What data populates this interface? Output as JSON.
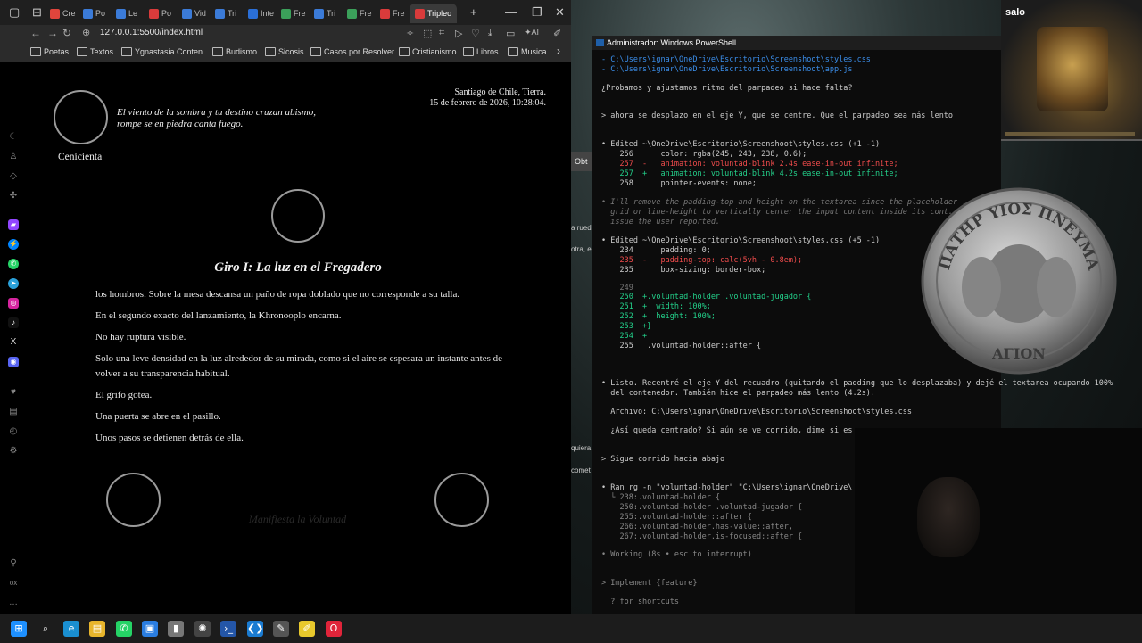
{
  "browser": {
    "tabs": [
      {
        "label": "Cre",
        "color": "#e0453c"
      },
      {
        "label": "Po",
        "color": "#3b7bd8"
      },
      {
        "label": "Le",
        "color": "#3b7bd8"
      },
      {
        "label": "Po",
        "color": "#d93b3b"
      },
      {
        "label": "Vid",
        "color": "#3b7bd8"
      },
      {
        "label": "Tri",
        "color": "#3b7bd8"
      },
      {
        "label": "Inte",
        "color": "#2a6fd8"
      },
      {
        "label": "Fre",
        "color": "#3ba05a"
      },
      {
        "label": "Tri",
        "color": "#3b7bd8"
      },
      {
        "label": "Fre",
        "color": "#3ba05a"
      },
      {
        "label": "Fre",
        "color": "#d93b3b"
      },
      {
        "label": "Tripleo",
        "color": "#d93b3b",
        "active": true
      }
    ],
    "new_tab_symbol": "+",
    "url": "127.0.0.1:5500/index.html",
    "ai_label": "AI",
    "bookmarks": [
      "Poetas",
      "Textos",
      "Ygnastasia Conten...",
      "Budismo",
      "Sicosis",
      "Casos por Resolver",
      "Cristianismo",
      "Libros",
      "Musica"
    ],
    "bookmarks_more": "›"
  },
  "page": {
    "quote_line1": "El viento de la sombra y tu destino cruzan abismo,",
    "quote_line2": "rompe se en piedra canta fuego.",
    "avatar_name": "Cenicienta",
    "location": "Santiago de Chile, Tierra.",
    "datetime": "15 de febrero de 2026, 10:28:04.",
    "chapter_title": "Giro I: La luz en el Fregadero",
    "paragraphs": [
      "los hombros. Sobre la mesa descansa un paño de ropa doblado que no corresponde a su talla.",
      "En el segundo exacto del lanzamiento, la Khronooplo encarna.",
      "No hay ruptura visible.",
      "Solo una leve densidad en la luz alrededor de su mirada, como si el aire se espesara un instante antes de volver a su transparencia habitual.",
      "El grifo gotea.",
      "Una puerta se abre en el pasillo.",
      "Unos pasos se detienen detrás de ella."
    ],
    "voluntad_placeholder": "Manifiesta la Voluntad"
  },
  "desktop": {
    "obt_label": "Obt",
    "clip_texts": [
      "a rueda",
      "otra, e",
      "quiera",
      "comet"
    ]
  },
  "powershell": {
    "title": "Administrador: Windows PowerShell",
    "lines": [
      {
        "t": "- C:\\Users\\ignar\\OneDrive\\Escritorio\\Screenshoot\\styles.css",
        "c": "path"
      },
      {
        "t": "- C:\\Users\\ignar\\OneDrive\\Escritorio\\Screenshoot\\app.js",
        "c": "path"
      },
      {
        "t": "¿Probamos y ajustamos ritmo del parpadeo si hace falta?",
        "c": ""
      },
      {
        "t": "> ahora se desplazo en el eje Y, que se centre. Que el parpadeo sea más lento",
        "c": ""
      },
      {
        "t": "• Edited ~\\OneDrive\\Escritorio\\Screenshoot\\styles.css (+1 -1)",
        "c": ""
      },
      {
        "t": "    256      color: rgba(245, 243, 238, 0.6);",
        "c": ""
      },
      {
        "t": "    257  -   animation: voluntad-blink 2.4s ease-in-out infinite;",
        "c": "red"
      },
      {
        "t": "    257  +   animation: voluntad-blink 4.2s ease-in-out infinite;",
        "c": "green"
      },
      {
        "t": "    258      pointer-events: none;",
        "c": ""
      },
      {
        "t": "• I'll remove the padding-top and height on the textarea since the placeholder ... se display",
        "c": "ital"
      },
      {
        "t": "  grid or line-height to vertically center the input content inside its cont... -shift",
        "c": "ital"
      },
      {
        "t": "  issue the user reported.",
        "c": "ital"
      },
      {
        "t": "• Edited ~\\OneDrive\\Escritorio\\Screenshoot\\styles.css (+5 -1)",
        "c": ""
      },
      {
        "t": "    234      padding: 0;",
        "c": ""
      },
      {
        "t": "    235  -   padding-top: calc(5vh - 0.8em);",
        "c": "red"
      },
      {
        "t": "    235      box-sizing: border-box;",
        "c": ""
      },
      {
        "t": "    249",
        "c": "lnum"
      },
      {
        "t": "    250  +.voluntad-holder .voluntad-jugador {",
        "c": "green"
      },
      {
        "t": "    251  +  width: 100%;",
        "c": "green"
      },
      {
        "t": "    252  +  height: 100%;",
        "c": "green"
      },
      {
        "t": "    253  +}",
        "c": "green"
      },
      {
        "t": "    254  +",
        "c": "green"
      },
      {
        "t": "    255   .voluntad-holder::after {",
        "c": ""
      },
      {
        "t": "• Listo. Recentré el eje Y del recuadro (quitando el padding que lo desplazaba) y dejé el textarea ocupando 100%",
        "c": ""
      },
      {
        "t": "  del contenedor. También hice el parpadeo más lento (4.2s).",
        "c": ""
      },
      {
        "t": "  Archivo: C:\\Users\\ignar\\OneDrive\\Escritorio\\Screenshoot\\styles.css",
        "c": ""
      },
      {
        "t": "  ¿Así queda centrado? Si aún se ve corrido, dime si es ...",
        "c": ""
      },
      {
        "t": "> Sigue corrido hacia abajo",
        "c": ""
      },
      {
        "t": "• Ran rg -n \"voluntad-holder\" \"C:\\Users\\ignar\\OneDrive\\",
        "c": ""
      },
      {
        "t": "  └ 238:.voluntad-holder {",
        "c": "dim"
      },
      {
        "t": "    250:.voluntad-holder .voluntad-jugador {",
        "c": "dim"
      },
      {
        "t": "    255:.voluntad-holder::after {",
        "c": "dim"
      },
      {
        "t": "    266:.voluntad-holder.has-value::after,",
        "c": "dim"
      },
      {
        "t": "    267:.voluntad-holder.is-focused::after {",
        "c": "dim"
      },
      {
        "t": "• Working (8s • esc to interrupt)",
        "c": "dim"
      },
      {
        "t": "> Implement {feature}",
        "c": "dim"
      },
      {
        "t": "  ? for shortcuts",
        "c": "dim"
      }
    ]
  },
  "overlays": {
    "salo_label": "salo",
    "coin_top_text": "ΠΑΤΗΡ ΥΙΟΣ ΠΝΕΥΜΑ",
    "coin_bottom_text": "ΑΓΙΟΝ"
  },
  "taskbar": {
    "items": [
      {
        "name": "windows-start-icon",
        "glyph": "⊞",
        "color": "#1e90ff"
      },
      {
        "name": "search-icon",
        "glyph": "⌕",
        "color": "#1c1c1c"
      },
      {
        "name": "edge-icon",
        "glyph": "e",
        "color": "#1a8fd1"
      },
      {
        "name": "file-explorer-icon",
        "glyph": "▤",
        "color": "#e8b52c"
      },
      {
        "name": "whatsapp-icon",
        "glyph": "✆",
        "color": "#25d366"
      },
      {
        "name": "app-icon",
        "glyph": "▣",
        "color": "#2a7de1"
      },
      {
        "name": "usb-icon",
        "glyph": "▮",
        "color": "#777"
      },
      {
        "name": "chatgpt-icon",
        "glyph": "✺",
        "color": "#444"
      },
      {
        "name": "powershell-icon",
        "glyph": "›_",
        "color": "#2456a8"
      },
      {
        "name": "vscode-icon",
        "glyph": "❮❯",
        "color": "#1a7bd1"
      },
      {
        "name": "paint-icon",
        "glyph": "✎",
        "color": "#555"
      },
      {
        "name": "notes-icon",
        "glyph": "✐",
        "color": "#e8c82c"
      },
      {
        "name": "opera-icon",
        "glyph": "O",
        "color": "#e0243a"
      }
    ]
  }
}
